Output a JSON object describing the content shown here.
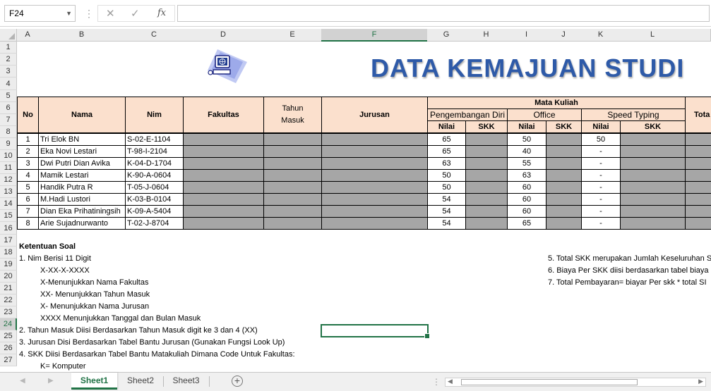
{
  "formula_bar": {
    "name_box": "F24",
    "cancel_icon": "✕",
    "enter_icon": "✓",
    "fx_label": "fx",
    "formula": ""
  },
  "columns": [
    "A",
    "B",
    "C",
    "D",
    "E",
    "F",
    "G",
    "H",
    "I",
    "J",
    "K",
    "L"
  ],
  "selected_column": "F",
  "rows": [
    "1",
    "2",
    "3",
    "4",
    "5",
    "6",
    "7",
    "8",
    "9",
    "10",
    "11",
    "12",
    "13",
    "14",
    "15",
    "16",
    "17",
    "18",
    "19",
    "20",
    "21",
    "22",
    "23",
    "24",
    "25",
    "26",
    "27"
  ],
  "selected_row": "24",
  "title": "DATA KEMAJUAN STUDI",
  "logo_icon": "computer-globe-icon",
  "table": {
    "headers": {
      "no": "No",
      "nama": "Nama",
      "nim": "Nim",
      "fakultas": "Fakultas",
      "tahun_masuk": "Tahun Masuk",
      "jurusan": "Jurusan",
      "mata_kuliah": "Mata Kuliah",
      "pengembangan_diri": "Pengembangan Diri",
      "office": "Office",
      "speed_typing": "Speed Typing",
      "total": "Tota",
      "nilai": "Nilai",
      "skk": "SKK"
    },
    "rows": [
      {
        "no": "1",
        "nama": "Tri Elok BN",
        "nim": "S-02-E-1104",
        "pd_nilai": "65",
        "office_nilai": "50",
        "st_nilai": "50"
      },
      {
        "no": "2",
        "nama": "Eka Novi Lestari",
        "nim": "T-98-I-2104",
        "pd_nilai": "65",
        "office_nilai": "40",
        "st_nilai": "-"
      },
      {
        "no": "3",
        "nama": "Dwi Putri Dian Avika",
        "nim": "K-04-D-1704",
        "pd_nilai": "63",
        "office_nilai": "55",
        "st_nilai": "-"
      },
      {
        "no": "4",
        "nama": "Mamik Lestari",
        "nim": "K-90-A-0604",
        "pd_nilai": "50",
        "office_nilai": "63",
        "st_nilai": "-"
      },
      {
        "no": "5",
        "nama": "Handik Putra R",
        "nim": "T-05-J-0604",
        "pd_nilai": "50",
        "office_nilai": "60",
        "st_nilai": "-"
      },
      {
        "no": "6",
        "nama": "M.Hadi Lustori",
        "nim": "K-03-B-0104",
        "pd_nilai": "54",
        "office_nilai": "60",
        "st_nilai": "-"
      },
      {
        "no": "7",
        "nama": "Dian Eka Prihatiningsih",
        "nim": "K-09-A-5404",
        "pd_nilai": "54",
        "office_nilai": "60",
        "st_nilai": "-"
      },
      {
        "no": "8",
        "nama": "Arie Sujadnurwanto",
        "nim": "T-02-J-8704",
        "pd_nilai": "54",
        "office_nilai": "65",
        "st_nilai": "-"
      }
    ]
  },
  "notes": {
    "heading": "Ketentuan Soal",
    "left": [
      "1. Nim Berisi 11 Digit",
      "X-XX-X-XXXX",
      "X-Menunjukkan Nama Fakultas",
      "XX- Menunjukkan Tahun Masuk",
      "X- Menunjukkan Nama Jurusan",
      "XXXX Menunjukkan Tanggal dan Bulan Masuk",
      "2. Tahun Masuk Diisi Berdasarkan Tahun Masuk digit ke 3 dan 4 (XX)",
      "3. Jurusan Disi Berdasarkan Tabel Bantu Jurusan (Gunakan Fungsi Look Up)",
      "4. SKK Diisi Berdasarkan Tabel Bantu Matakuliah Dimana Code Untuk Fakultas:",
      "K= Komputer"
    ],
    "right": [
      "5. Total SKK merupakan Jumlah Keseluruhan SK",
      "6. Biaya Per SKK diisi berdasarkan tabel biaya",
      "7. Total Pembayaran= biayar Per skk * total SI"
    ]
  },
  "sheets": {
    "tabs": [
      "Sheet1",
      "Sheet2",
      "Sheet3"
    ],
    "active": "Sheet1",
    "add_icon": "+"
  },
  "colors": {
    "header_fill": "#fbe0cd",
    "grey_fill": "#a6a6a6",
    "title_blue": "#2e5aa8",
    "excel_green": "#217346"
  }
}
